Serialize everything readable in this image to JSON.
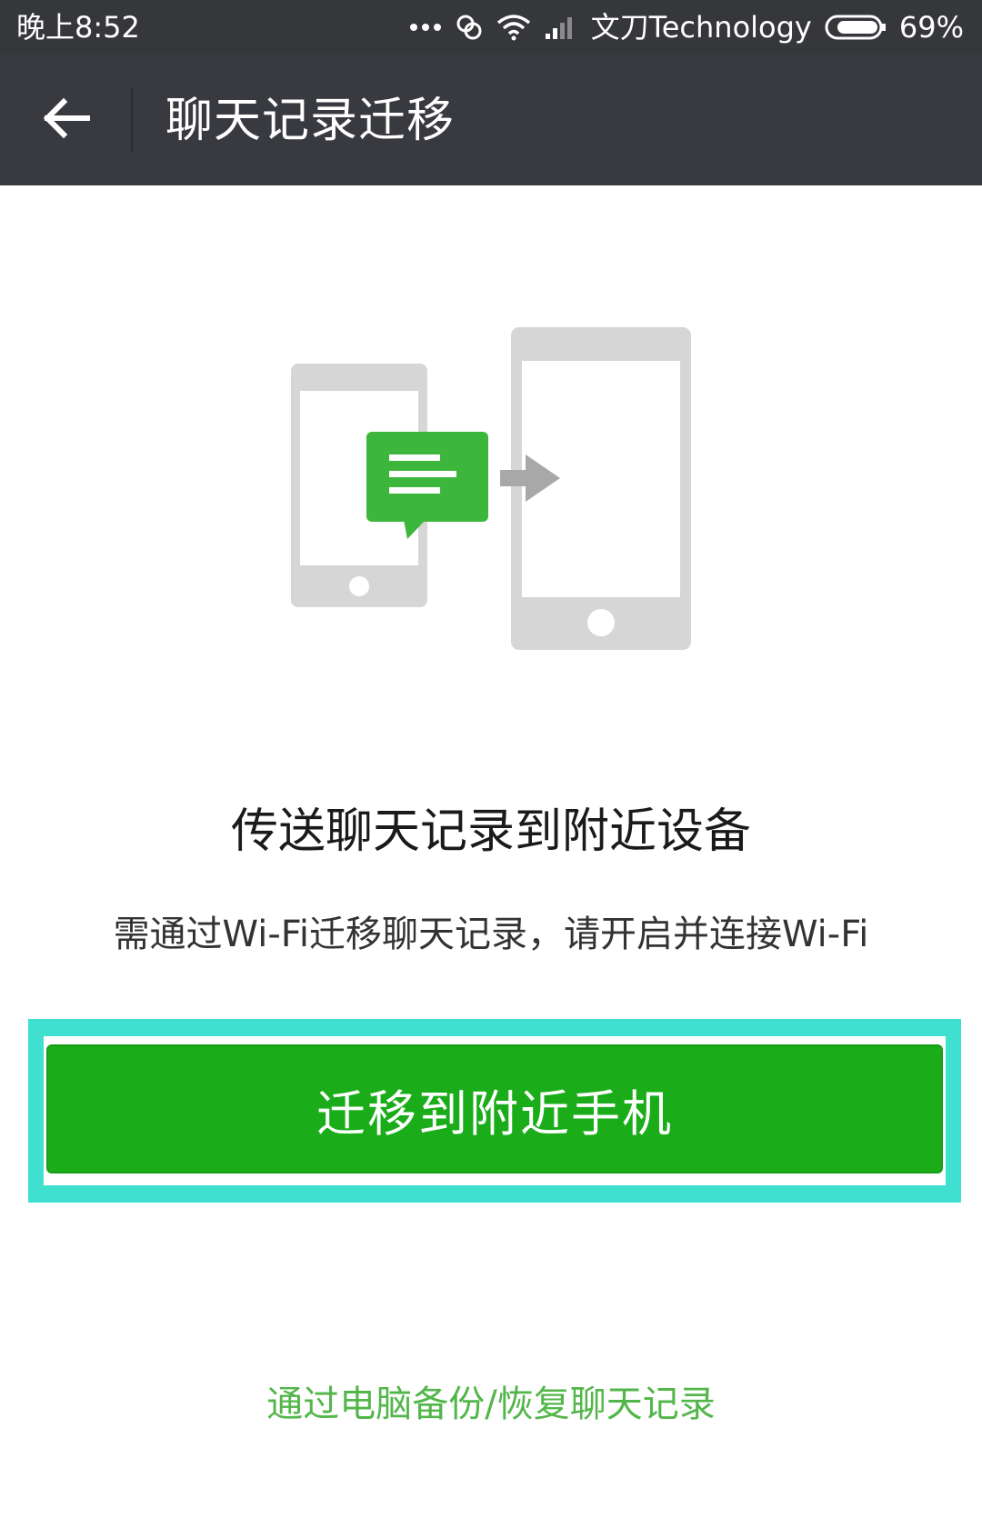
{
  "status_bar": {
    "time": "晚上8:52",
    "carrier": "文刀Technology",
    "battery": "69%",
    "icons": [
      "more-dots-icon",
      "sync-icon",
      "wifi-icon",
      "signal-icon",
      "battery-icon"
    ]
  },
  "title_bar": {
    "title": "聊天记录迁移",
    "back_icon": "back-arrow-icon"
  },
  "main": {
    "illustration": "phone-to-phone-transfer-icon",
    "heading": "传送聊天记录到附近设备",
    "subtext": "需通过Wi-Fi迁移聊天记录，请开启并连接Wi-Fi",
    "migrate_button": "迁移到附近手机",
    "pc_link": "通过电脑备份/恢复聊天记录"
  },
  "colors": {
    "status_bar_bg": "#36373b",
    "title_bar_bg": "#393a3f",
    "button_green": "#1aad19",
    "chat_bubble_green": "#3db73b",
    "highlight": "#3fe0d0",
    "link_green": "#53b64a",
    "phone_gray": "#d6d6d6",
    "arrow_gray": "#a8a8a8"
  }
}
